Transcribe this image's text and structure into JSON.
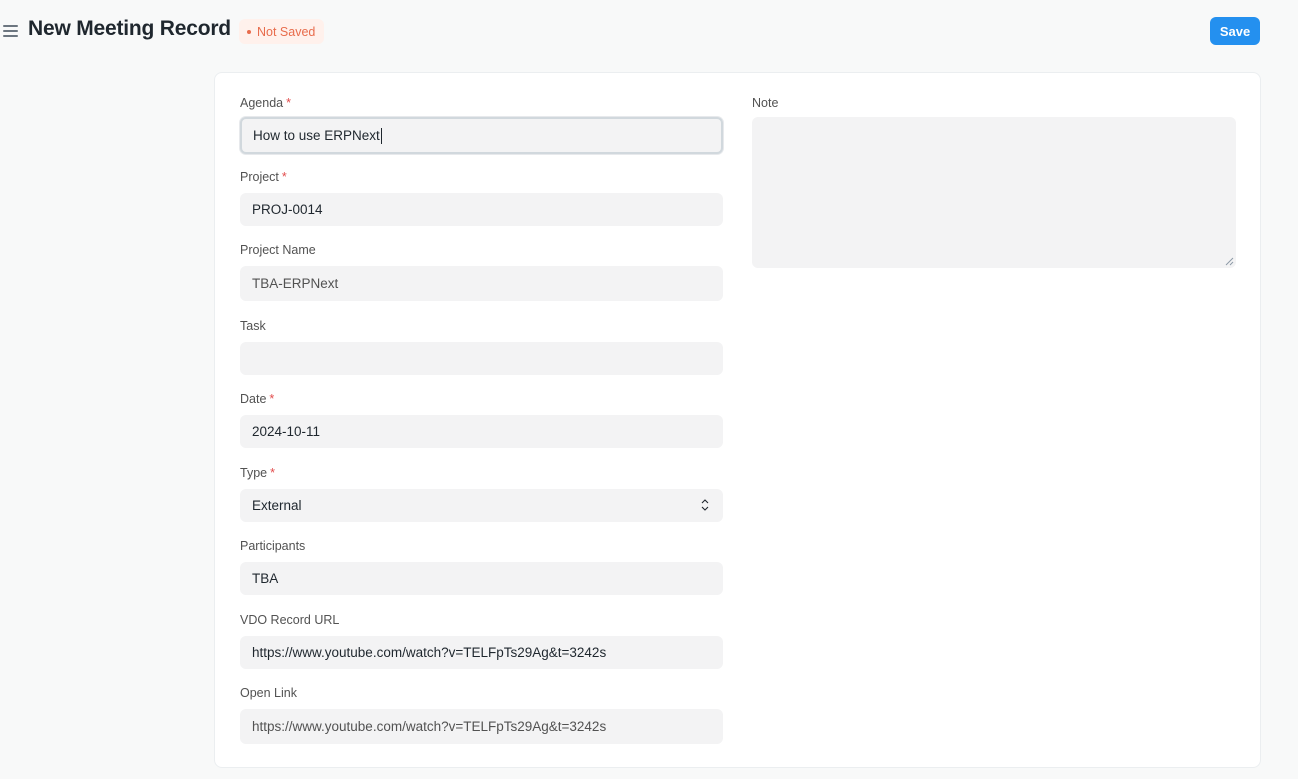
{
  "header": {
    "title": "New Meeting Record",
    "status": "Not Saved",
    "save_label": "Save"
  },
  "form": {
    "agenda": {
      "label": "Agenda",
      "required": "*",
      "value": "How to use ERPNext"
    },
    "project": {
      "label": "Project",
      "required": "*",
      "value": "PROJ-0014"
    },
    "project_name": {
      "label": "Project Name",
      "value": "TBA-ERPNext"
    },
    "task": {
      "label": "Task",
      "value": ""
    },
    "date": {
      "label": "Date",
      "required": "*",
      "value": "2024-10-11"
    },
    "type": {
      "label": "Type",
      "required": "*",
      "value": "External"
    },
    "participants": {
      "label": "Participants",
      "value": "TBA"
    },
    "vdo_record_url": {
      "label": "VDO Record URL",
      "value": "https://www.youtube.com/watch?v=TELFpTs29Ag&t=3242s"
    },
    "open_link": {
      "label": "Open Link",
      "value": "https://www.youtube.com/watch?v=TELFpTs29Ag&t=3242s"
    },
    "note": {
      "label": "Note",
      "value": ""
    }
  },
  "colors": {
    "accent": "#2490ef",
    "required": "#e24c4c",
    "status_bg": "#fff1ec",
    "status_text": "#e86c4c",
    "field_bg": "#f3f3f4"
  },
  "icons": [
    "menu-icon",
    "select-arrows-icon",
    "resize-grip-icon"
  ]
}
